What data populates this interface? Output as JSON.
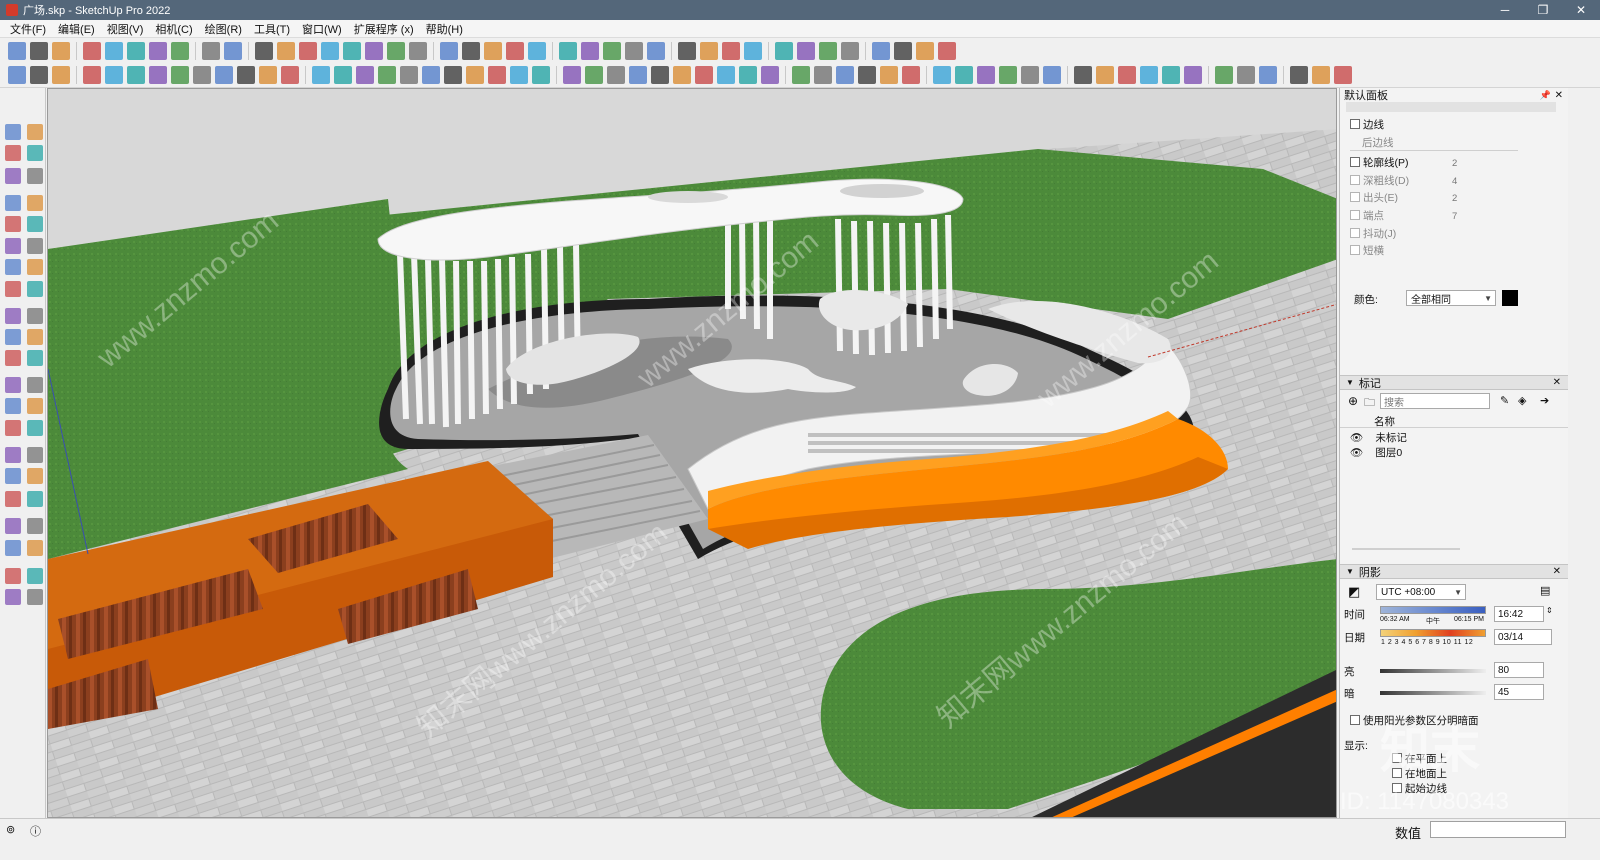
{
  "window": {
    "title": "广场.skp - SketchUp Pro 2022"
  },
  "menu": [
    "文件(F)",
    "编辑(E)",
    "视图(V)",
    "相机(C)",
    "绘图(R)",
    "工具(T)",
    "窗口(W)",
    "扩展程序 (x)",
    "帮助(H)"
  ],
  "tray": {
    "title": "默认面板",
    "styles": {
      "edges": "边线",
      "back_edges": "后边线",
      "profiles": "轮廓线(P)",
      "profiles_val": "2",
      "depth_cue": "深粗线(D)",
      "depth_cue_val": "4",
      "extension": "出头(E)",
      "extension_val": "2",
      "endpoints": "端点",
      "endpoints_val": "7",
      "jitter": "抖动(J)",
      "dashes": "短横",
      "color_label": "颜色:",
      "color_value": "全部相同",
      "swatch": "#000000"
    },
    "tags": {
      "title": "标记",
      "search_placeholder": "搜索",
      "name_header": "名称",
      "items": [
        "未标记",
        "图层0"
      ]
    },
    "shadows": {
      "title": "阴影",
      "timezone": "UTC +08:00",
      "time_label": "时间",
      "date_label": "日期",
      "sunrise": "06:32 AM",
      "noon": "中午",
      "sunset": "06:15 PM",
      "months": "1 2 3 4 5 6 7 8 9 10 11 12",
      "time_value": "16:42",
      "date_value": "03/14",
      "light_label": "亮",
      "light_value": "80",
      "light_level": 0.8,
      "dark_label": "暗",
      "dark_value": "45",
      "dark_level": 0.45,
      "use_sun": "使用阳光参数区分明暗面",
      "display_label": "显示:",
      "on_faces": "在平面上",
      "on_ground": "在地面上",
      "from_edges": "起始边线"
    }
  },
  "status": {
    "measurements_label": "数值"
  },
  "watermarks": {
    "site": "www.znzmo.com",
    "brand": "知末",
    "cn_site": "知末网www.znzmo.com",
    "id": "ID: 1147080343"
  }
}
